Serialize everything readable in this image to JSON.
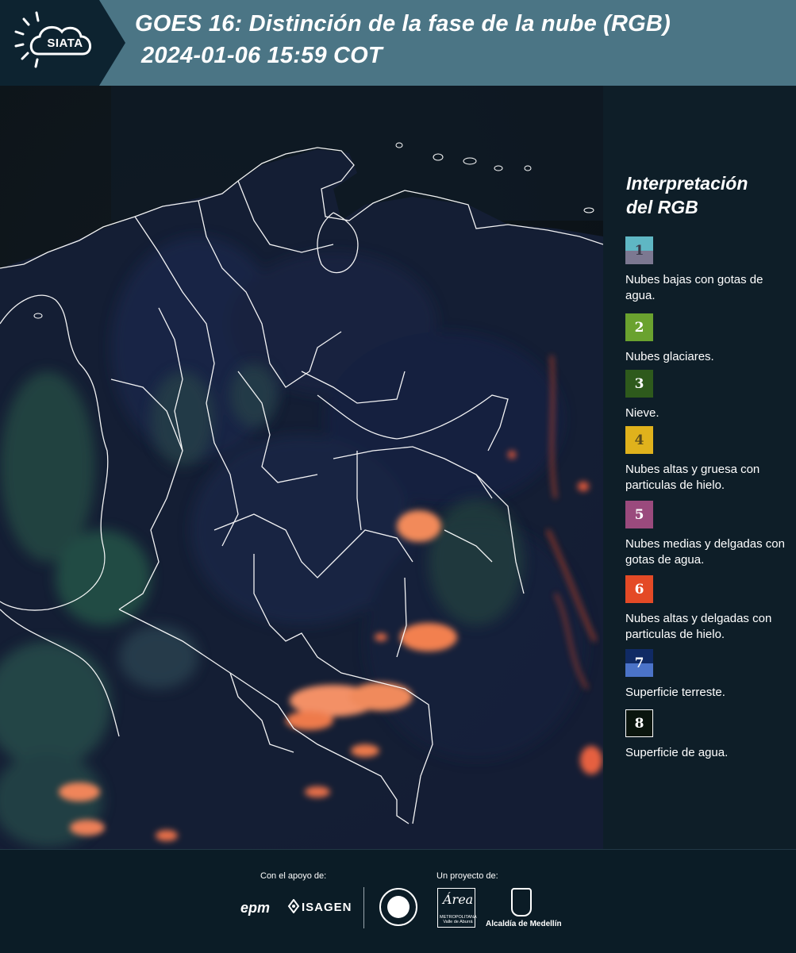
{
  "header": {
    "logo_text": "SIATA",
    "title_line1": "GOES 16: Distinción de la fase de la nube (RGB)",
    "title_line2": "2024-01-06 15:59 COT"
  },
  "legend": {
    "title_line1": "Interpretación",
    "title_line2": "del RGB",
    "items": [
      {
        "number": "1",
        "label": "Nubes bajas con gotas de agua.",
        "color_top": "#5fb7c4",
        "color_bottom": "#7c7891",
        "text_color": "#3a3a4a"
      },
      {
        "number": "2",
        "label": "Nubes glaciares.",
        "color_top": "#6aa22f",
        "color_bottom": "#6aa22f",
        "text_color": "#ffffff"
      },
      {
        "number": "3",
        "label": "Nieve.",
        "color_top": "#2e5a1c",
        "color_bottom": "#2e5a1c",
        "text_color": "#ffffff"
      },
      {
        "number": "4",
        "label": "Nubes altas y gruesa con particulas de hielo.",
        "color_top": "#e0b21c",
        "color_bottom": "#e0b21c",
        "text_color": "#5a4a1a"
      },
      {
        "number": "5",
        "label": "Nubes medias y delgadas con gotas de agua.",
        "color_top": "#9a4a7d",
        "color_bottom": "#9a4a7d",
        "text_color": "#ffffff"
      },
      {
        "number": "6",
        "label": "Nubes altas y delgadas con particulas de hielo.",
        "color_top": "#e44a26",
        "color_bottom": "#e44a26",
        "text_color": "#ffffff"
      },
      {
        "number": "7",
        "label": "Superficie terreste.",
        "color_top": "#102a64",
        "color_bottom": "#4b73c8",
        "text_color": "#ffffff"
      },
      {
        "number": "8",
        "label": "Superficie de agua.",
        "color_top": "#0a150e",
        "color_bottom": "#0a150e",
        "text_color": "#ffffff"
      }
    ]
  },
  "footer": {
    "support_label": "Con el apoyo de:",
    "project_label": "Un proyecto de:",
    "epm_text": "epm",
    "isagen_text": "ISAGEN",
    "area_script": "Área",
    "area_small": "METROPOLITANA Valle de Aburrá",
    "alcaldia_text": "Alcaldía de Medellín"
  },
  "colors": {
    "header_bg": "#4b7585",
    "panel_bg": "#0e1e28",
    "map_bg": "#0c141c"
  }
}
